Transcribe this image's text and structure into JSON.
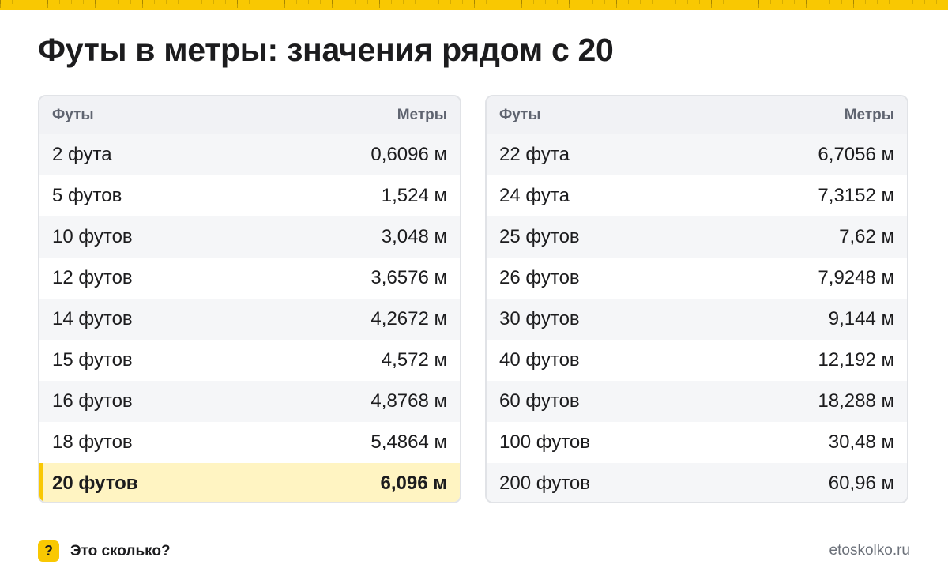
{
  "title": "Футы в метры: значения рядом с 20",
  "accent_color": "#f9c802",
  "tables": [
    {
      "header": {
        "col1": "Футы",
        "col2": "Метры"
      },
      "rows": [
        {
          "feet": "2 фута",
          "meters": "0,6096 м"
        },
        {
          "feet": "5 футов",
          "meters": "1,524 м"
        },
        {
          "feet": "10 футов",
          "meters": "3,048 м"
        },
        {
          "feet": "12 футов",
          "meters": "3,6576 м"
        },
        {
          "feet": "14 футов",
          "meters": "4,2672 м"
        },
        {
          "feet": "15 футов",
          "meters": "4,572 м"
        },
        {
          "feet": "16 футов",
          "meters": "4,8768 м"
        },
        {
          "feet": "18 футов",
          "meters": "5,4864 м"
        },
        {
          "feet": "20 футов",
          "meters": "6,096 м"
        }
      ]
    },
    {
      "header": {
        "col1": "Футы",
        "col2": "Метры"
      },
      "rows": [
        {
          "feet": "22 фута",
          "meters": "6,7056 м"
        },
        {
          "feet": "24 фута",
          "meters": "7,3152 м"
        },
        {
          "feet": "25 футов",
          "meters": "7,62 м"
        },
        {
          "feet": "26 футов",
          "meters": "7,9248 м"
        },
        {
          "feet": "30 футов",
          "meters": "9,144 м"
        },
        {
          "feet": "40 футов",
          "meters": "12,192 м"
        },
        {
          "feet": "60 футов",
          "meters": "18,288 м"
        },
        {
          "feet": "100 футов",
          "meters": "30,48 м"
        },
        {
          "feet": "200 футов",
          "meters": "60,96 м"
        }
      ]
    }
  ],
  "footer": {
    "icon_symbol": "?",
    "brand": "Это сколько?",
    "site": "etoskolko.ru"
  }
}
